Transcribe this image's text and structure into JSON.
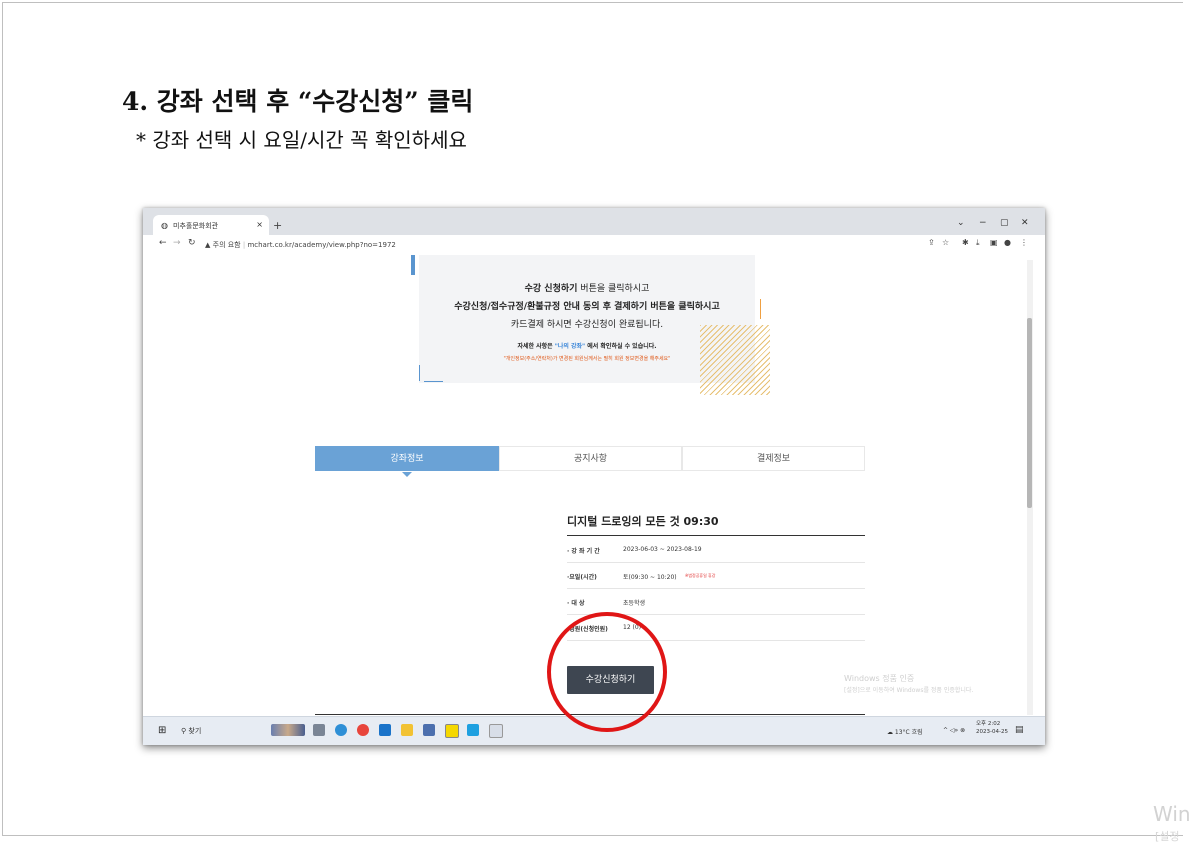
{
  "document": {
    "title": "4. 강좌 선택 후 “수강신청” 클릭",
    "subtitle": "* 강좌 선택 시 요일/시간 꼭 확인하세요",
    "corner_watermark": "Win",
    "corner_watermark_sub": "[설정"
  },
  "browser": {
    "tab_title": "미추홀문화회관",
    "address_warning": "주의 요함",
    "url": "mchart.co.kr/academy/view.php?no=1972"
  },
  "banner": {
    "line1_bold": "수강 신청하기",
    "line1_rest": " 버튼을 클릭하시고",
    "line2": "수강신청/접수규정/환불규정 안내 동의 후 결제하기 버튼을 클릭하시고",
    "line3": "카드결제 하시면 수강신청이 완료됩니다.",
    "line4_pre": "자세한 사항은 ",
    "line4_link": "\"나의 강좌\"",
    "line4_post": " 에서 확인하실 수 있습니다.",
    "line5": "\"개인정보(주소/연락처)가 변경된 회원님께서는 필히 회원 정보변경을 해주세요\""
  },
  "tabs": [
    {
      "label": "강좌정보",
      "active": true
    },
    {
      "label": "공지사항",
      "active": false
    },
    {
      "label": "결제정보",
      "active": false
    }
  ],
  "course": {
    "title": "디지털 드로잉의 모든 것 09:30",
    "rows": [
      {
        "key": "· 강 좌 기 간",
        "value": "2023-06-03 ~ 2023-08-19",
        "note": ""
      },
      {
        "key": "·요일(시간)",
        "value": "토(09:30 ~ 10:20)",
        "note": "※법정공휴일 휴강"
      },
      {
        "key": "·  대    상",
        "value": "초등학생",
        "note": ""
      },
      {
        "key": "·정원(신청인원)",
        "value": "12 (0)",
        "note": ""
      }
    ],
    "apply_button": "수강신청하기"
  },
  "windows_activation": {
    "line1": "Windows 정품 인증",
    "line2": "[설정]으로 이동하여 Windows를 정품 인증합니다."
  },
  "taskbar": {
    "search_label": "찾기",
    "weather": "13°C 흐림",
    "time": "오후 2:02",
    "date": "2023-04-25"
  },
  "colors": {
    "accent_blue": "#6aa2d6",
    "button_dark": "#3e4651",
    "annotation_red": "#e01616"
  }
}
